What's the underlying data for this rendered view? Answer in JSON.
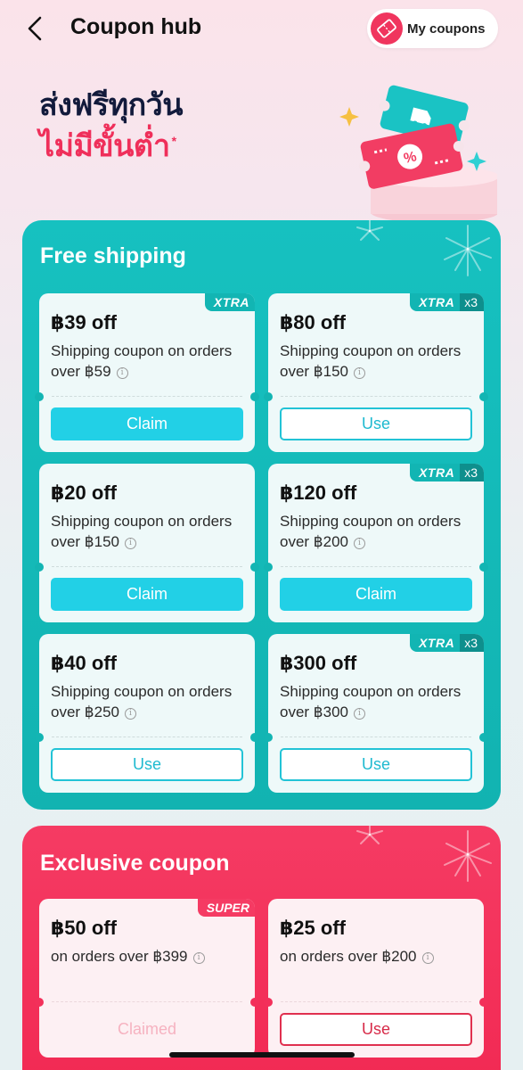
{
  "header": {
    "title": "Coupon hub",
    "my_coupons_label": "My coupons"
  },
  "hero": {
    "line1": "ส่งฟรีทุกวัน",
    "line2": "ไม่มีขั้นต่ำ",
    "asterisk": "*"
  },
  "free_shipping": {
    "title": "Free shipping",
    "coupons": [
      {
        "amount": "฿39 off",
        "desc": "Shipping coupon on orders over ฿59",
        "tag": "XTRA",
        "count": "",
        "button": "Claim",
        "button_style": "claim"
      },
      {
        "amount": "฿80 off",
        "desc": "Shipping coupon on orders over ฿150",
        "tag": "XTRA",
        "count": "x3",
        "button": "Use",
        "button_style": "use"
      },
      {
        "amount": "฿20 off",
        "desc": "Shipping coupon on orders over ฿150",
        "tag": "",
        "count": "",
        "button": "Claim",
        "button_style": "claim"
      },
      {
        "amount": "฿120 off",
        "desc": "Shipping coupon on orders over ฿200",
        "tag": "XTRA",
        "count": "x3",
        "button": "Claim",
        "button_style": "claim"
      },
      {
        "amount": "฿40 off",
        "desc": "Shipping coupon on orders over ฿250",
        "tag": "",
        "count": "",
        "button": "Use",
        "button_style": "use"
      },
      {
        "amount": "฿300 off",
        "desc": "Shipping coupon on orders over ฿300",
        "tag": "XTRA",
        "count": "x3",
        "button": "Use",
        "button_style": "use"
      }
    ]
  },
  "exclusive": {
    "title": "Exclusive coupon",
    "coupons": [
      {
        "amount": "฿50 off",
        "desc": "on orders over ฿399",
        "tag": "SUPER",
        "button": "Claimed",
        "button_style": "claimed"
      },
      {
        "amount": "฿25 off",
        "desc": "on orders over ฿200",
        "tag": "",
        "button": "Use",
        "button_style": "use-red"
      }
    ]
  },
  "colors": {
    "teal_section": "#16c1c0",
    "red_section": "#f53b63",
    "claim_button": "#22d0e6",
    "hero_accent": "#ef2f5a"
  },
  "icons": {
    "back": "chevron-left-icon",
    "my_coupons": "ticket-icon",
    "info": "info-icon"
  }
}
